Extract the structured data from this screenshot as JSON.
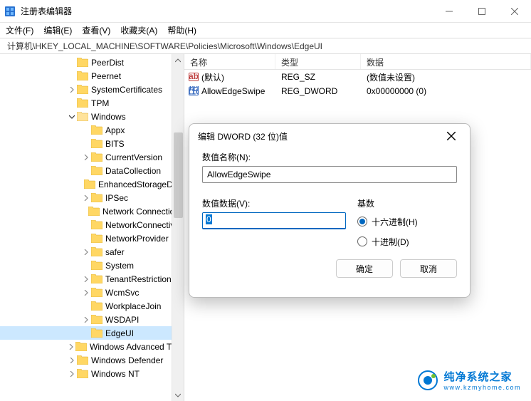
{
  "window": {
    "title": "注册表编辑器"
  },
  "menu": {
    "file": "文件(F)",
    "edit": "编辑(E)",
    "view": "查看(V)",
    "favorites": "收藏夹(A)",
    "help": "帮助(H)"
  },
  "address": "计算机\\HKEY_LOCAL_MACHINE\\SOFTWARE\\Policies\\Microsoft\\Windows\\EdgeUI",
  "tree": {
    "items": [
      {
        "label": "PeerDist",
        "indent": 96,
        "chev": "none"
      },
      {
        "label": "Peernet",
        "indent": 96,
        "chev": "none"
      },
      {
        "label": "SystemCertificates",
        "indent": 96,
        "chev": "closed"
      },
      {
        "label": "TPM",
        "indent": 96,
        "chev": "none"
      },
      {
        "label": "Windows",
        "indent": 96,
        "chev": "open",
        "open": true
      },
      {
        "label": "Appx",
        "indent": 116,
        "chev": "none"
      },
      {
        "label": "BITS",
        "indent": 116,
        "chev": "none"
      },
      {
        "label": "CurrentVersion",
        "indent": 116,
        "chev": "closed"
      },
      {
        "label": "DataCollection",
        "indent": 116,
        "chev": "none"
      },
      {
        "label": "EnhancedStorageDevices",
        "indent": 116,
        "chev": "none"
      },
      {
        "label": "IPSec",
        "indent": 116,
        "chev": "closed"
      },
      {
        "label": "Network Connections",
        "indent": 116,
        "chev": "none"
      },
      {
        "label": "NetworkConnectivity",
        "indent": 116,
        "chev": "none"
      },
      {
        "label": "NetworkProvider",
        "indent": 116,
        "chev": "none"
      },
      {
        "label": "safer",
        "indent": 116,
        "chev": "closed"
      },
      {
        "label": "System",
        "indent": 116,
        "chev": "none"
      },
      {
        "label": "TenantRestrictions",
        "indent": 116,
        "chev": "closed"
      },
      {
        "label": "WcmSvc",
        "indent": 116,
        "chev": "closed"
      },
      {
        "label": "WorkplaceJoin",
        "indent": 116,
        "chev": "none"
      },
      {
        "label": "WSDAPI",
        "indent": 116,
        "chev": "closed"
      },
      {
        "label": "EdgeUI",
        "indent": 116,
        "chev": "none",
        "selected": true
      },
      {
        "label": "Windows Advanced Threat Protection",
        "indent": 96,
        "chev": "closed"
      },
      {
        "label": "Windows Defender",
        "indent": 96,
        "chev": "closed"
      },
      {
        "label": "Windows NT",
        "indent": 96,
        "chev": "closed"
      }
    ]
  },
  "list": {
    "headers": {
      "name": "名称",
      "type": "类型",
      "data": "数据"
    },
    "rows": [
      {
        "icon": "sz",
        "name": "(默认)",
        "type": "REG_SZ",
        "data": "(数值未设置)"
      },
      {
        "icon": "dw",
        "name": "AllowEdgeSwipe",
        "type": "REG_DWORD",
        "data": "0x00000000 (0)"
      }
    ]
  },
  "dialog": {
    "title": "编辑 DWORD (32 位)值",
    "name_label": "数值名称(N):",
    "name_value": "AllowEdgeSwipe",
    "data_label": "数值数据(V):",
    "data_value": "0",
    "base_label": "基数",
    "hex_label": "十六进制(H)",
    "dec_label": "十进制(D)",
    "ok": "确定",
    "cancel": "取消"
  },
  "watermark": {
    "cn": "纯净系统之家",
    "url": "www.kzmyhome.com"
  }
}
